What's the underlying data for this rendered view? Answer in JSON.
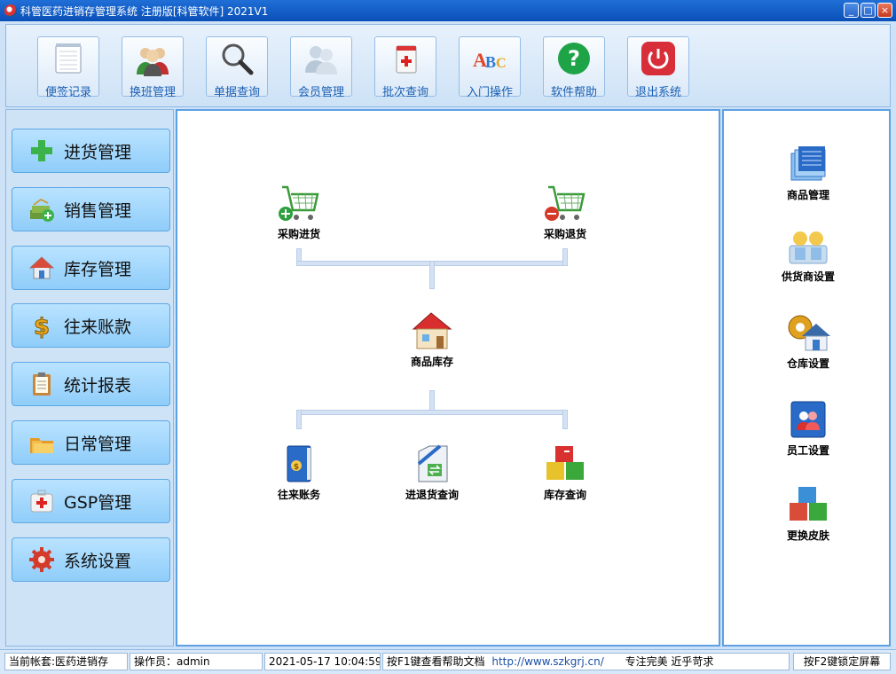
{
  "window": {
    "title": "科管医药进销存管理系统 注册版[科管软件] 2021V1",
    "min": "_",
    "max": "□",
    "close": "×"
  },
  "toolbar": {
    "items": [
      {
        "label": "便签记录",
        "icon": "notepad-icon"
      },
      {
        "label": "换班管理",
        "icon": "users-group-icon"
      },
      {
        "label": "单据查询",
        "icon": "magnifier-icon"
      },
      {
        "label": "会员管理",
        "icon": "members-icon"
      },
      {
        "label": "批次查询",
        "icon": "medicine-box-icon"
      },
      {
        "label": "入门操作",
        "icon": "abc-icon"
      },
      {
        "label": "软件帮助",
        "icon": "help-icon"
      },
      {
        "label": "退出系统",
        "icon": "power-icon"
      }
    ]
  },
  "sidebar": {
    "items": [
      {
        "label": "进货管理",
        "icon": "plus-icon"
      },
      {
        "label": "销售管理",
        "icon": "money-stack-icon"
      },
      {
        "label": "库存管理",
        "icon": "house-icon"
      },
      {
        "label": "往来账款",
        "icon": "dollar-icon"
      },
      {
        "label": "统计报表",
        "icon": "clipboard-icon"
      },
      {
        "label": "日常管理",
        "icon": "folders-icon"
      },
      {
        "label": "GSP管理",
        "icon": "medkit-icon"
      },
      {
        "label": "系统设置",
        "icon": "gear-icon"
      }
    ]
  },
  "flow": {
    "purchase_in": "采购进货",
    "purchase_return": "采购退货",
    "inventory": "商品库存",
    "accounts": "往来账务",
    "in_return_query": "进退货查询",
    "stock_query": "库存查询"
  },
  "right": {
    "items": [
      {
        "label": "商品管理",
        "icon": "documents-stack-icon"
      },
      {
        "label": "供货商设置",
        "icon": "supplier-icon"
      },
      {
        "label": "仓库设置",
        "icon": "warehouse-gear-icon"
      },
      {
        "label": "员工设置",
        "icon": "staff-card-icon"
      },
      {
        "label": "更换皮肤",
        "icon": "cubes-icon"
      }
    ]
  },
  "status": {
    "account": "当前帐套:医药进销存",
    "operator": "操作员：admin",
    "datetime": "2021-05-17 10:04:59",
    "help_text": "按F1键查看帮助文档",
    "url": "http://www.szkgrj.cn/",
    "slogan": "专注完美 近乎苛求",
    "lock": "按F2键锁定屏幕"
  }
}
